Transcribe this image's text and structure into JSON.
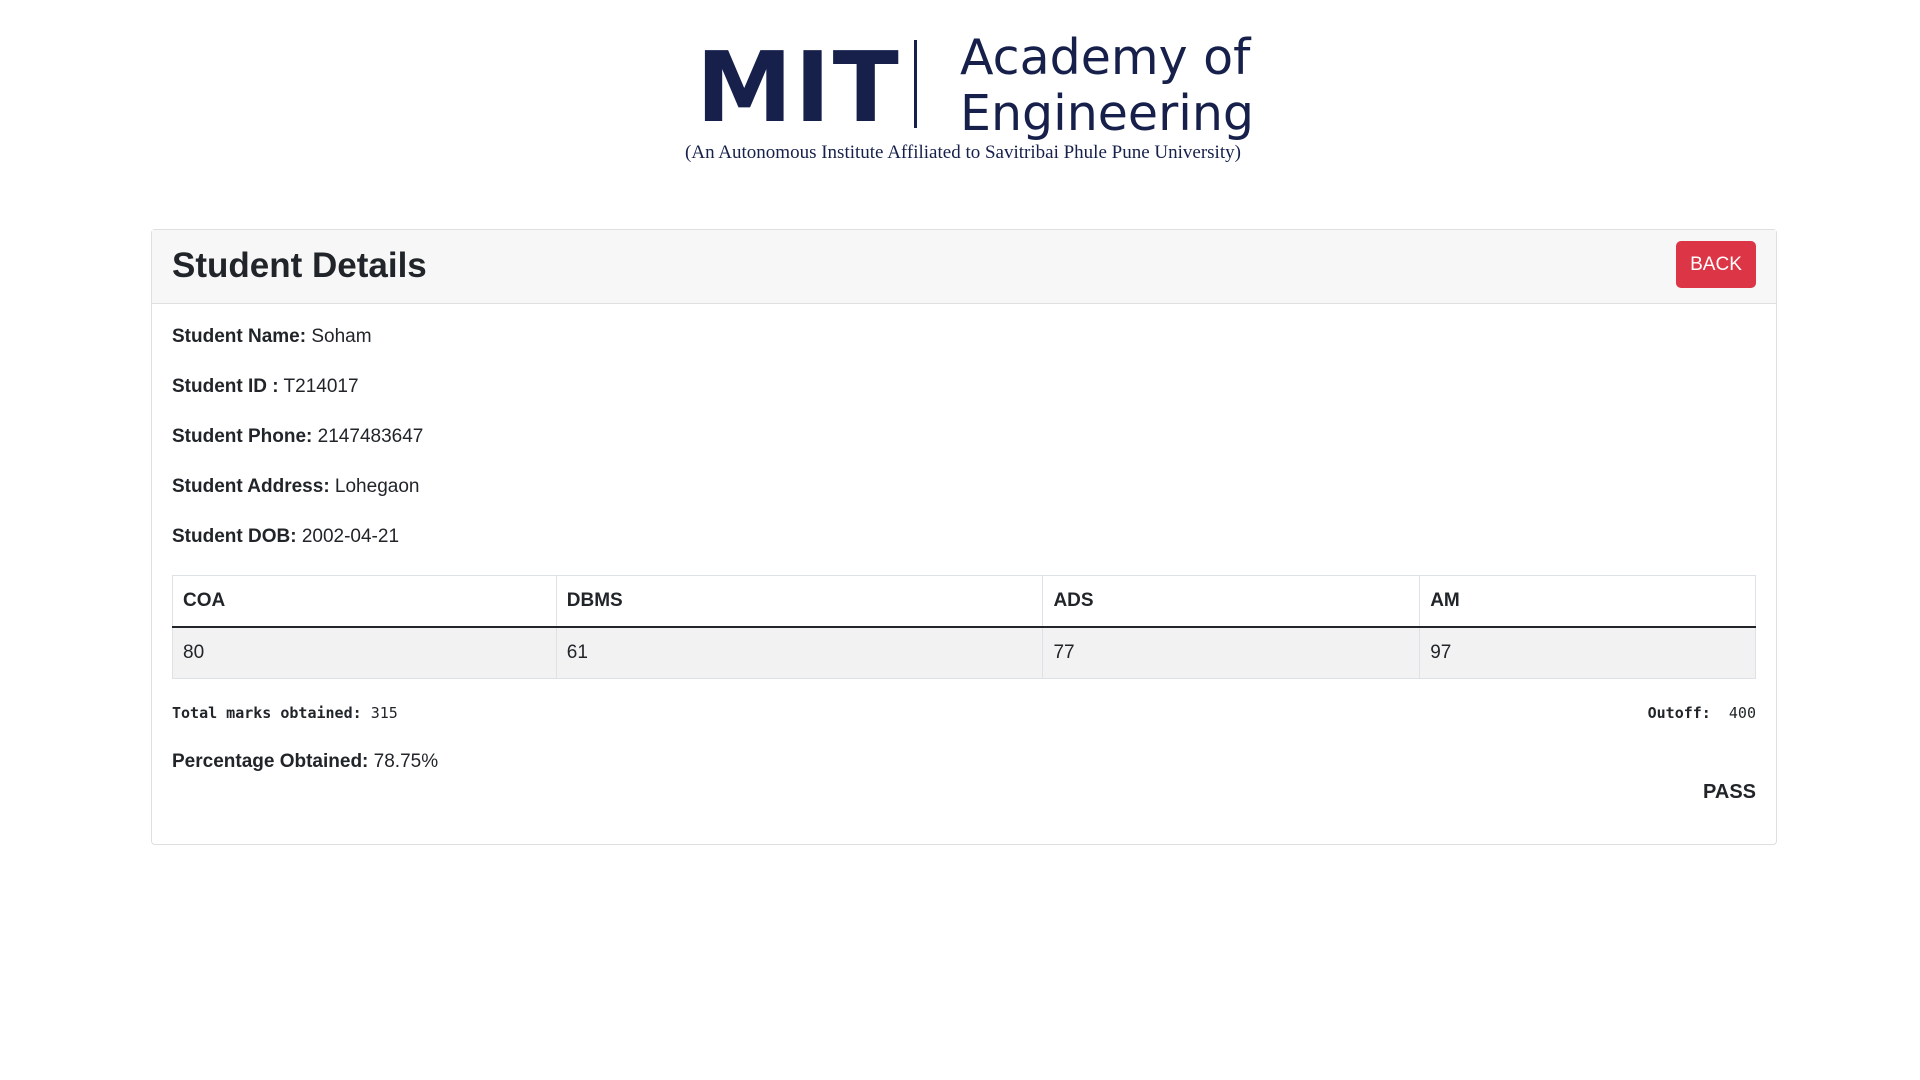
{
  "logo": {
    "brand": "MIT",
    "name": "Academy of\nEngineering",
    "tagline": "(An Autonomous Institute Affiliated to Savitribai Phule Pune University)",
    "color": "#16204a"
  },
  "card": {
    "title": "Student Details",
    "back_label": "BACK",
    "back_color": "#dc3545"
  },
  "student": {
    "name_label": "Student Name:",
    "name": "Soham",
    "id_label": "Student ID :",
    "id": "T214017",
    "phone_label": "Student Phone:",
    "phone": "2147483647",
    "address_label": "Student Address:",
    "address": "Lohegaon",
    "dob_label": "Student DOB:",
    "dob": "2002-04-21"
  },
  "marks": {
    "headers": [
      "COA",
      "DBMS",
      "ADS",
      "AM"
    ],
    "values": [
      "80",
      "61",
      "77",
      "97"
    ]
  },
  "summary": {
    "total_label": "Total marks obtained:",
    "total": "315",
    "outoff_label": "Outoff:",
    "outoff": "400",
    "percentage_label": "Percentage Obtained:",
    "percentage": "78.75%",
    "result": "PASS"
  }
}
